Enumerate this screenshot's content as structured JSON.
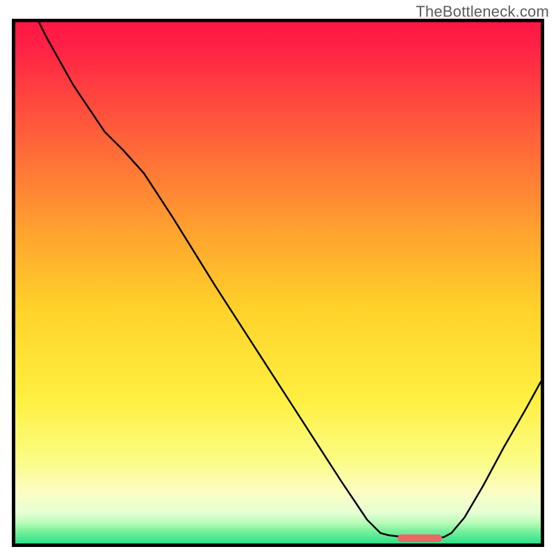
{
  "watermark": "TheBottleneck.com",
  "chart_data": {
    "type": "line",
    "title": "",
    "xlabel": "",
    "ylabel": "",
    "xlim": [
      0,
      100
    ],
    "ylim": [
      0,
      100
    ],
    "gradient_background": {
      "stops": [
        {
          "offset": 0.0,
          "color": "#ff1744"
        },
        {
          "offset": 0.04,
          "color": "#ff1f46"
        },
        {
          "offset": 0.2,
          "color": "#ff5a3b"
        },
        {
          "offset": 0.4,
          "color": "#ffa22f"
        },
        {
          "offset": 0.55,
          "color": "#ffd22a"
        },
        {
          "offset": 0.72,
          "color": "#ffef40"
        },
        {
          "offset": 0.84,
          "color": "#fbfc84"
        },
        {
          "offset": 0.9,
          "color": "#fcfdc2"
        },
        {
          "offset": 0.94,
          "color": "#e6ffd4"
        },
        {
          "offset": 0.96,
          "color": "#bafcb8"
        },
        {
          "offset": 0.975,
          "color": "#7ef09f"
        },
        {
          "offset": 0.99,
          "color": "#4be88f"
        },
        {
          "offset": 1.0,
          "color": "#2fe085"
        }
      ]
    },
    "series": [
      {
        "name": "bottleneck-curve",
        "stroke": "#000000",
        "stroke_width": 2.5,
        "points": [
          {
            "x": 4.5,
            "y": 100.0
          },
          {
            "x": 6.0,
            "y": 97.0
          },
          {
            "x": 11.0,
            "y": 88.0
          },
          {
            "x": 17.0,
            "y": 79.0
          },
          {
            "x": 20.5,
            "y": 75.5
          },
          {
            "x": 24.5,
            "y": 71.0
          },
          {
            "x": 30.0,
            "y": 62.5
          },
          {
            "x": 38.0,
            "y": 49.5
          },
          {
            "x": 46.0,
            "y": 37.0
          },
          {
            "x": 54.0,
            "y": 24.5
          },
          {
            "x": 62.0,
            "y": 12.0
          },
          {
            "x": 67.0,
            "y": 4.5
          },
          {
            "x": 69.5,
            "y": 2.0
          },
          {
            "x": 71.0,
            "y": 1.6
          },
          {
            "x": 72.5,
            "y": 1.4
          },
          {
            "x": 77.0,
            "y": 1.2
          },
          {
            "x": 81.5,
            "y": 1.2
          },
          {
            "x": 83.0,
            "y": 2.0
          },
          {
            "x": 85.5,
            "y": 5.0
          },
          {
            "x": 89.0,
            "y": 11.0
          },
          {
            "x": 93.0,
            "y": 18.5
          },
          {
            "x": 97.0,
            "y": 25.5
          },
          {
            "x": 100.0,
            "y": 31.0
          }
        ]
      }
    ],
    "marker": {
      "color": "#f06565",
      "x_start": 73.5,
      "x_end": 80.5,
      "y": 1.0,
      "stroke_width": 11,
      "linecap": "round"
    },
    "frame": {
      "stroke": "#000000",
      "stroke_width": 5
    }
  }
}
